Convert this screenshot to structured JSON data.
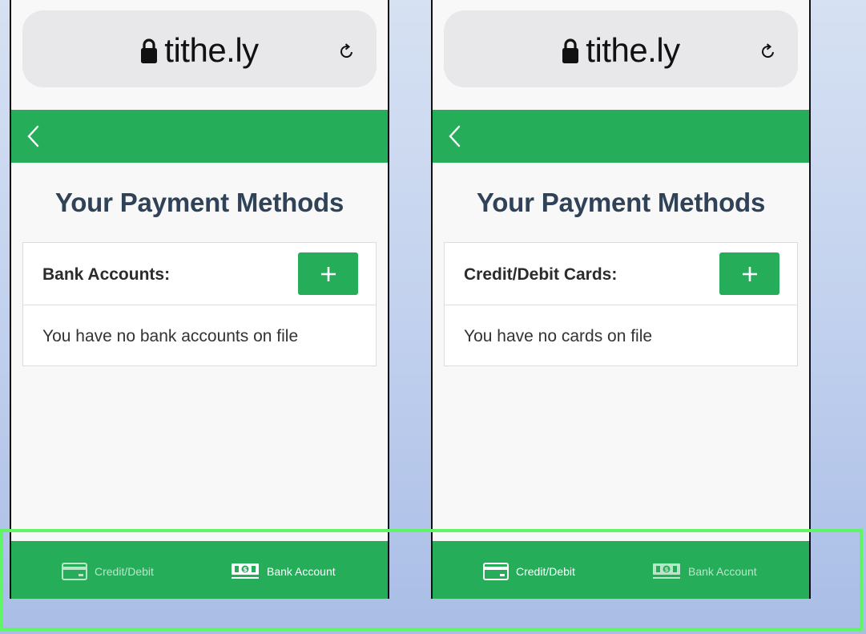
{
  "colors": {
    "brand_green": "#26ad5a",
    "title_navy": "#2f4258",
    "highlight": "#5ff565"
  },
  "screens": [
    {
      "url": "tithe.ly",
      "page_title": "Your Payment Methods",
      "section_label": "Bank Accounts:",
      "empty_message": "You have no bank accounts on file",
      "active_tab": "bank",
      "tabs": {
        "credit_label": "Credit/Debit",
        "bank_label": "Bank Account"
      }
    },
    {
      "url": "tithe.ly",
      "page_title": "Your Payment Methods",
      "section_label": "Credit/Debit Cards:",
      "empty_message": "You have no cards on file",
      "active_tab": "credit",
      "tabs": {
        "credit_label": "Credit/Debit",
        "bank_label": "Bank Account"
      }
    }
  ],
  "icons": [
    "lock-icon",
    "reload-icon",
    "back-chevron-icon",
    "plus-icon",
    "credit-card-icon",
    "cash-icon"
  ]
}
